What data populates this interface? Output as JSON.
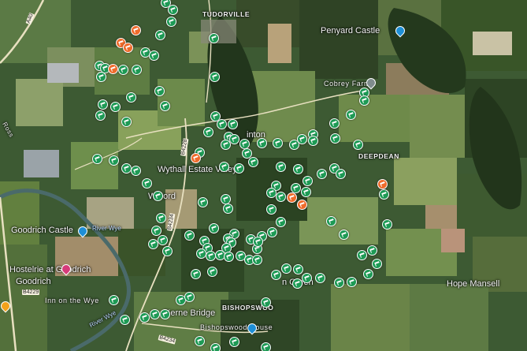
{
  "map": {
    "labels": {
      "tudorville": "TUDORVILLE",
      "penyard_castle": "Penyard Castle",
      "cobrey_farms": "Cobrey Farms",
      "deepdean": "DEEPDEAN",
      "hinton": "inton",
      "wythall": "Wythall Estate Vineya",
      "walford": "Wa  ord",
      "goodrich_castle": "Goodrich Castle",
      "river_wye_1": "River Wye",
      "river_wye_2": "River Wye",
      "hostelrie": "Hostelrie at Goodrich",
      "goodrich": "Goodrich",
      "inn_on_the_wye": "Inn on the Wye",
      "kerne_bridge": "Kerne  Bridge",
      "bishopswood": "BISHOPSWOO",
      "bishopswood_house": "Bishopswood House",
      "howle_green": "  n Green",
      "hope_mansell": "Hope Mansell",
      "road_b4228": "B4228",
      "road_b4234": "B4234",
      "road_b4229": "B4229",
      "road_b4234b": "B4234",
      "road_a40": "A40",
      "road_ross": "Ross"
    },
    "colors": {
      "green_pin": "#1e9a55",
      "orange_pin": "#ef6b2b",
      "place_marker_blue": "#1e8fd6"
    },
    "icons": {
      "green_pin": "camera-icon",
      "orange_pin": "camera-icon"
    }
  }
}
